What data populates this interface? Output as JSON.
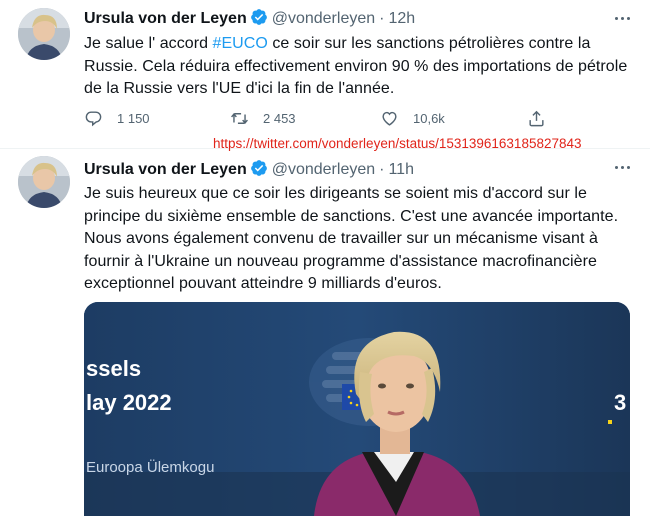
{
  "tweets": [
    {
      "name": "Ursula von der Leyen",
      "handle": "@vonderleyen",
      "dot": "·",
      "time": "12h",
      "text_before": "Je salue l' accord ",
      "hashtag": "#EUCO",
      "text_after": " ce soir sur les sanctions pétrolières contre la Russie. Cela réduira effectivement environ 90 % des importations de pétrole de la Russie vers l'UE d'ici la fin de l'année.",
      "reply_count": "1 150",
      "retweet_count": "2 453",
      "like_count": "10,6k"
    },
    {
      "name": "Ursula von der Leyen",
      "handle": "@vonderleyen",
      "dot": "·",
      "time": "11h",
      "text": "Je suis heureux que ce soir les dirigeants se soient mis d'accord sur le principe du sixième ensemble de sanctions. C'est une avancée importante. Nous avons également convenu de travailler sur un mécanisme visant à fournir à l'Ukraine un nouveau programme d'assistance macrofinancière exceptionnel pouvant atteindre 9 milliards d'euros.",
      "media": {
        "backdrop_line1": "ssels",
        "backdrop_line2": "lay 2022",
        "backdrop_line3": "Euroopa Ülemkogu",
        "backdrop_right": "3"
      }
    }
  ],
  "annotation_url": "https://twitter.com/vonderleyen/status/1531396163185827843",
  "colors": {
    "accent": "#1d9bf0",
    "secondary_text": "#536471",
    "annotation": "#e0241a"
  }
}
